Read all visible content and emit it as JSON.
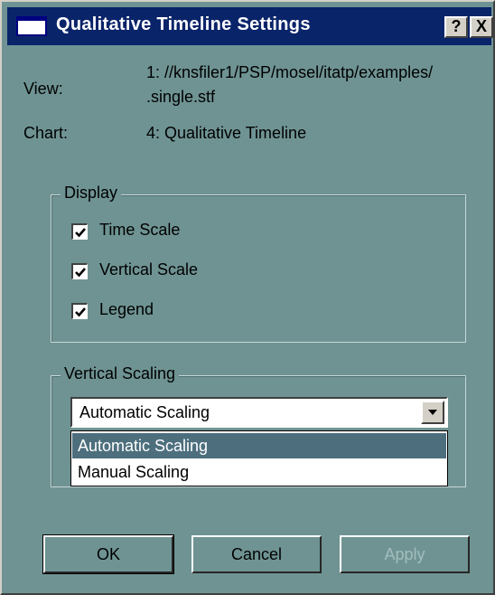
{
  "window": {
    "title": "Qualitative Timeline Settings",
    "help_label": "?",
    "close_label": "X"
  },
  "info": {
    "view_label": "View:",
    "view_value_line1": "1: //knsfiler1/PSP/mosel/itatp/examples/",
    "view_value_line2": ".single.stf",
    "chart_label": "Chart:",
    "chart_value": "4: Qualitative Timeline"
  },
  "display": {
    "title": "Display",
    "options": [
      {
        "label": "Time Scale",
        "checked": true
      },
      {
        "label": "Vertical Scale",
        "checked": true
      },
      {
        "label": "Legend",
        "checked": true
      }
    ]
  },
  "vertical_scaling": {
    "title": "Vertical Scaling",
    "selected": "Automatic Scaling",
    "options": [
      "Automatic Scaling",
      "Manual Scaling"
    ],
    "dropdown_open": true
  },
  "buttons": {
    "ok": "OK",
    "cancel": "Cancel",
    "apply": "Apply",
    "apply_enabled": false
  },
  "colors": {
    "dialog_bg": "#6f9393",
    "titlebar": "#0a246a",
    "selection": "#4d6f7d"
  }
}
